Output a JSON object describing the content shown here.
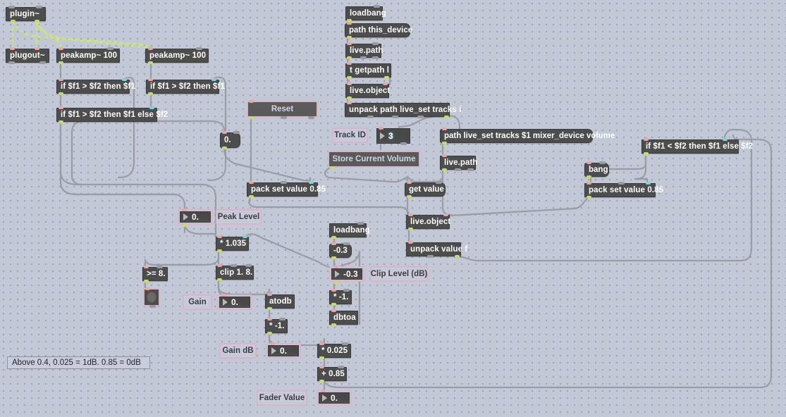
{
  "app": {
    "title": "Max for Live patcher",
    "background_color": "#c3c8d6",
    "signal_cord_color": "#cfe86b",
    "message_cord_color": "#9c9ca4"
  },
  "objects": {
    "plugin": "plugin~",
    "plugout": "plugout~",
    "peakamp_left": "peakamp~ 100",
    "peakamp_right": "peakamp~ 100",
    "expr_gt_left": "if $f1 > $f2 then $f1",
    "expr_gt_right": "if $f1 > $f2 then $f1",
    "expr_gt_else": "if $f1 > $f2 then $f1 else $f2",
    "loadbang_top": "loadbang",
    "path_this_device": "path this_device",
    "live_path_1": "live.path",
    "t_getpath": "t getpath l",
    "live_object_1": "live.object",
    "unpack_path": "unpack path live_set tracks i",
    "path_volume": "path live_set tracks $1 mixer_device volume",
    "live_path_2": "live.path",
    "get_value": "get value",
    "live_object_2": "live.object",
    "unpack_value_f": "unpack value f",
    "expr_lt_else": "if $f1 < $f2 then $f1 else $f2",
    "bang": "bang",
    "pack_left": "pack set value 0.85",
    "pack_right": "pack set value 0.85",
    "mult_1035": "* 1.035",
    "clip": "clip 1. 8.",
    "gte_8": ">= 8.",
    "atodb": "atodb",
    "mult_neg1_a": "* -1.",
    "loadbang_clip": "loadbang",
    "msg_neg03": "-0.3",
    "mult_neg1_b": "* -1.",
    "dbtoa": "dbtoa",
    "mult_0025": "* 0.025",
    "add_085": "+ 0.85",
    "msg_zero": "0."
  },
  "labels": {
    "reset": "Reset",
    "store_current_volume": "Store Current Volume",
    "track_id": "Track ID",
    "peak_level": "Peak Level",
    "clip_level_db": "Clip Level (dB)",
    "gain": "Gain",
    "gain_db": "Gain dB",
    "fader_value": "Fader Value"
  },
  "values": {
    "track_id_number": "3",
    "peak_level_number": "0.",
    "clip_level_number": "-0.3",
    "gain_number": "0.",
    "gain_db_number": "0.",
    "fader_value_number": "0.",
    "message_zero": "0."
  },
  "comment": {
    "note": "Above 0.4, 0.025 = 1dB. 0.85 = 0dB"
  }
}
